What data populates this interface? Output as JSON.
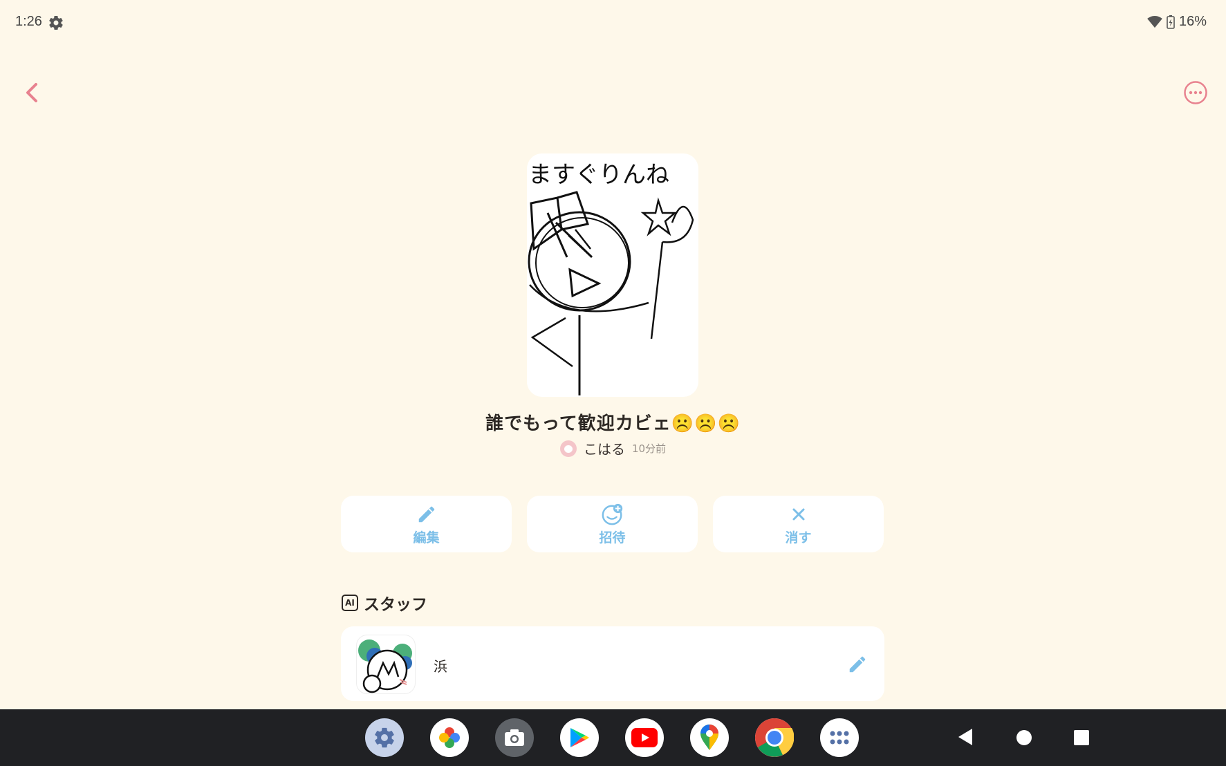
{
  "status_bar": {
    "time": "1:26",
    "battery": "16%",
    "icons": [
      "settings-gear-icon",
      "wifi-icon",
      "battery-charging-icon"
    ]
  },
  "header": {
    "back_icon": "chevron-left-icon",
    "more_icon": "more-horizontal-icon",
    "accent_color": "#e8828f"
  },
  "room": {
    "title": "誰でもって歓迎カビェ☹️☹️☹️",
    "owner_name": "こはる",
    "posted_time": "10分前",
    "art_caption": "ますぐりんね"
  },
  "actions": [
    {
      "label": "編集",
      "icon": "pencil-icon"
    },
    {
      "label": "招待",
      "icon": "invite-user-plus-icon"
    },
    {
      "label": "消す",
      "icon": "close-x-icon"
    }
  ],
  "staff": {
    "section_badge": "AI",
    "section_title": "スタッフ",
    "members": [
      {
        "name": "浜",
        "edit_icon": "pencil-icon"
      }
    ]
  },
  "dock": {
    "apps": [
      "settings-app-icon",
      "photos-app-icon",
      "camera-app-icon",
      "play-store-app-icon",
      "youtube-app-icon",
      "maps-app-icon",
      "chrome-app-icon",
      "app-drawer-icon"
    ]
  },
  "colors": {
    "background": "#fef8ea",
    "action_blue": "#7cbfe8",
    "navbar": "#202124"
  }
}
